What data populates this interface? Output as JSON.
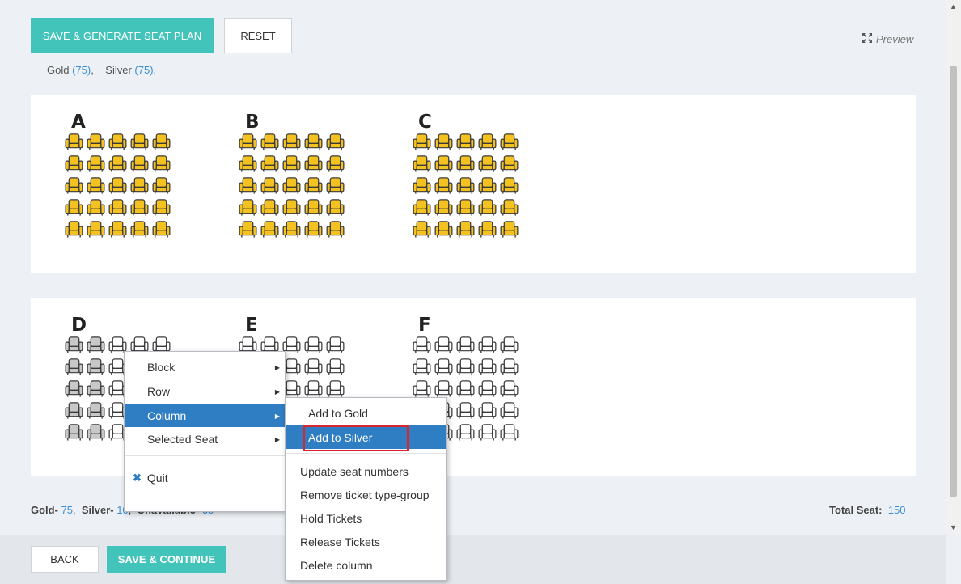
{
  "toolbar": {
    "save_generate_label": "SAVE & GENERATE SEAT PLAN",
    "reset_label": "RESET",
    "preview_label": "Preview"
  },
  "legend_top": {
    "gold_label": "Gold",
    "gold_count": "(75)",
    "silver_label": "Silver",
    "silver_count": "(75)"
  },
  "sections": {
    "a": "A",
    "b": "B",
    "c": "C",
    "d": "D",
    "e": "E",
    "f": "F"
  },
  "colors": {
    "gold_seat": "#f3c221",
    "unavailable_seat": "#c8c8c8",
    "empty_seat": "#ffffff",
    "accent_teal": "#43c4ba",
    "menu_active": "#2f7dc2"
  },
  "bottom_info": {
    "gold_label": "Gold-",
    "gold_value": "75",
    "silver_label": "Silver-",
    "silver_value": "10",
    "unavailable_label": "Unavailable-",
    "unavailable_value": "65",
    "total_label": "Total Seat:",
    "total_value": "150"
  },
  "footer": {
    "back_label": "BACK",
    "save_continue_label": "SAVE & CONTINUE"
  },
  "context_menu": {
    "items": [
      {
        "label": "Block"
      },
      {
        "label": "Row"
      },
      {
        "label": "Column"
      },
      {
        "label": "Selected Seat"
      }
    ],
    "quit_label": "Quit"
  },
  "submenu": {
    "add_gold": "Add to  Gold",
    "add_silver": "Add to  Silver",
    "update_numbers": "Update seat numbers",
    "remove_group": "Remove ticket type-group",
    "hold": "Hold Tickets",
    "release": "Release Tickets",
    "delete_column": "Delete column"
  }
}
